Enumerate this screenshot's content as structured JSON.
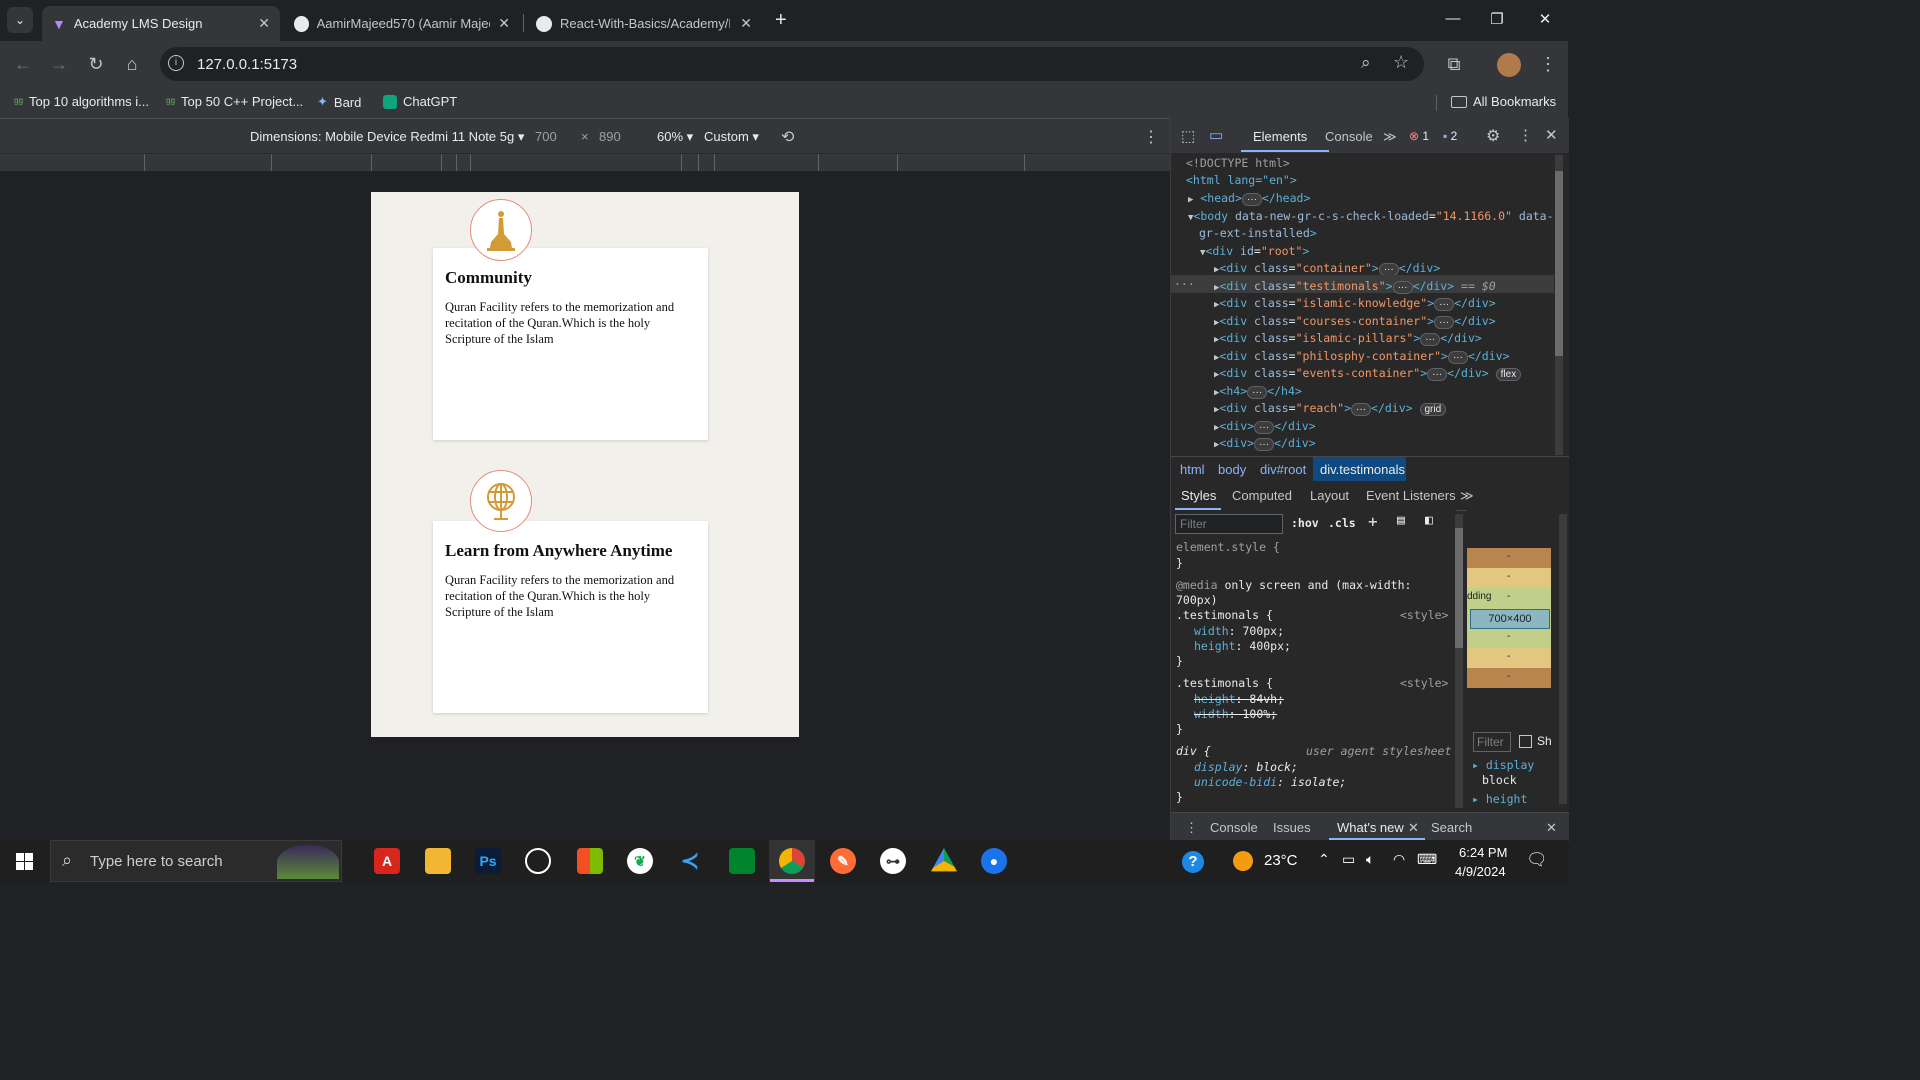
{
  "tabs": [
    {
      "title": "Academy LMS Design",
      "active": true
    },
    {
      "title": "AamirMajeed570 (Aamir Majeed)",
      "active": false
    },
    {
      "title": "React-With-Basics/Academy/RE",
      "active": false
    }
  ],
  "address": {
    "url": "127.0.0.1:5173"
  },
  "bookmarks": [
    "Top 10 algorithms i...",
    "Top 50 C++ Project...",
    "Bard",
    "ChatGPT"
  ],
  "all_bookmarks": "All Bookmarks",
  "device_toolbar": {
    "dimensions": "Dimensions: Mobile Device Redmi 11 Note 5g",
    "width": "700",
    "times": "×",
    "height": "890",
    "zoom": "60%",
    "throttle": "Custom"
  },
  "page": {
    "cards": [
      {
        "title": "Community",
        "text": "Quran Facility refers to the memorization and recitation of the Quran.Which is the holy Scripture of the Islam",
        "icon": "meditation-icon"
      },
      {
        "title": "Learn from Anywhere Anytime",
        "text": "Quran Facility refers to the memorization and recitation of the Quran.Which is the holy Scripture of the Islam",
        "icon": "globe-icon"
      }
    ]
  },
  "devtools": {
    "tabs": [
      "Elements",
      "Console"
    ],
    "error_count": "1",
    "message_count": "2",
    "dom": {
      "doctype": "<!DOCTYPE html>",
      "html_open": "<html lang=\"en\">",
      "head": "<head>",
      "head_close": "</head>",
      "body_attr1": "data-new-gr-c-s-check-loaded",
      "body_val1": "\"14.1166.0\"",
      "body_attr2_a": "data-",
      "body_attr2_b": "gr-ext-installed",
      "root_id": "\"root\"",
      "divs": [
        {
          "class": "\"container\""
        },
        {
          "class": "\"testimonals\"",
          "selected": true,
          "suffix": "== $0"
        },
        {
          "class": "\"islamic-knowledge\""
        },
        {
          "class": "\"courses-container\""
        },
        {
          "class": "\"islamic-pillars\""
        },
        {
          "class": "\"philosphy-container\""
        },
        {
          "class": "\"events-container\"",
          "badge": "flex"
        },
        {
          "tag": "h4"
        },
        {
          "class": "\"reach\"",
          "badge": "grid"
        },
        {
          "tag": "div"
        },
        {
          "tag": "div"
        }
      ]
    },
    "breadcrumbs": [
      "html",
      "body",
      "div#root",
      "div.testimonals"
    ],
    "style_tabs": [
      "Styles",
      "Computed",
      "Layout",
      "Event Listeners"
    ],
    "filter_placeholder": "Filter",
    "hov": ":hov",
    "cls": ".cls",
    "styles": {
      "element_style": "element.style {",
      "close": "}",
      "media_kw": "@media",
      "media_rest": "only screen and (max-width:",
      "media_rest2": "700px)",
      "selector": ".testimonals {",
      "source": "<style>",
      "width_prop": "width",
      "width_val": "700px;",
      "height_prop": "height",
      "height_val": "400px;",
      "height2_val": "84vh;",
      "width2_val": "100%;",
      "ua_selector": "div {",
      "ua_source": "user agent stylesheet",
      "display_prop": "display",
      "display_val": "block;",
      "bidi_prop": "unicode-bidi",
      "bidi_val": "isolate;"
    },
    "boxmodel": {
      "size": "700×400",
      "dash": "-",
      "padding_label": "dding"
    },
    "computed": {
      "filter": "Filter",
      "show": "Sh",
      "display_label": "display",
      "display_value": "block",
      "height_label": "height"
    },
    "drawer_tabs": [
      "Console",
      "Issues",
      "What's new",
      "Search"
    ]
  },
  "taskbar": {
    "search_placeholder": "Type here to search",
    "weather": "23°C",
    "time": "6:24 PM",
    "date": "4/9/2024"
  }
}
